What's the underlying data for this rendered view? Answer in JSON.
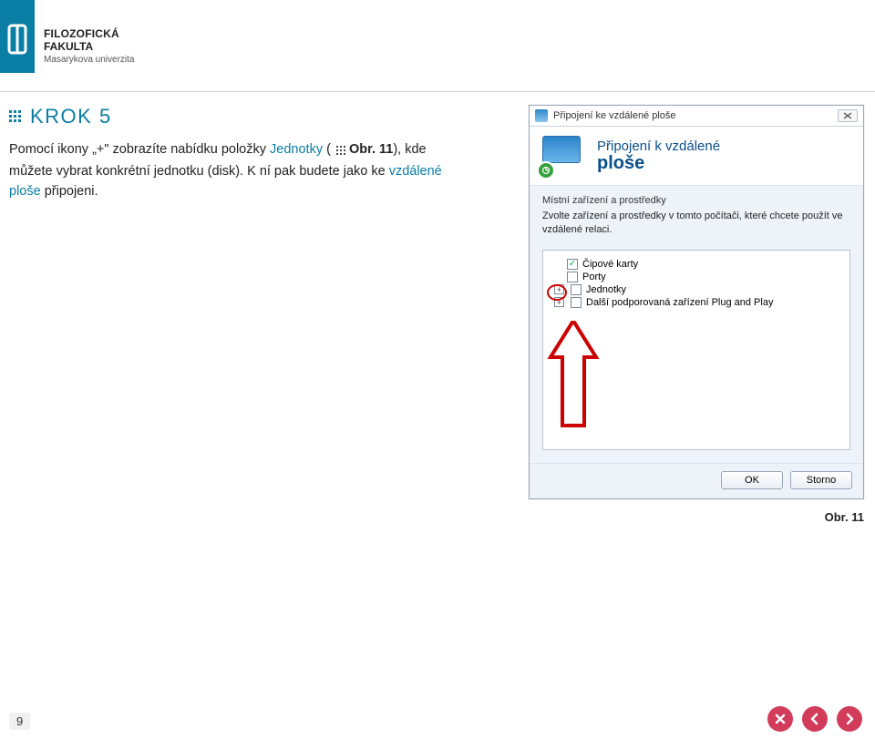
{
  "header": {
    "org_line1": "FILOZOFICKÁ",
    "org_line2": "FAKULTA",
    "org_line3": "Masarykova univerzita"
  },
  "step": {
    "label": "KROK 5"
  },
  "paragraph": {
    "p1_a": "Pomocí ikony „+\" zobrazíte nabídku položky ",
    "p1_link1": "Jednotky",
    "p1_b": " ( ",
    "p1_ref": "Obr. 11",
    "p1_c": "), kde můžete vybrat konkrétní jednotku (disk). K ní pak budete jako ke ",
    "p1_link2": "vzdálené ploše",
    "p1_d": " připojeni."
  },
  "dialog": {
    "title": "Připojení ke vzdálené ploše",
    "heading1": "Připojení k vzdálené",
    "heading2": "ploše",
    "section_label": "Místní zařízení a prostředky",
    "section_sub": "Zvolte zařízení a prostředky v tomto počítači, které chcete použít ve vzdálené relaci.",
    "tree": {
      "item1": "Čipové karty",
      "item2": "Porty",
      "item3": "Jednotky",
      "item4": "Další podporovaná zařízení Plug and Play"
    },
    "buttons": {
      "ok": "OK",
      "cancel": "Storno"
    }
  },
  "caption": "Obr. 11",
  "page_number": "9"
}
